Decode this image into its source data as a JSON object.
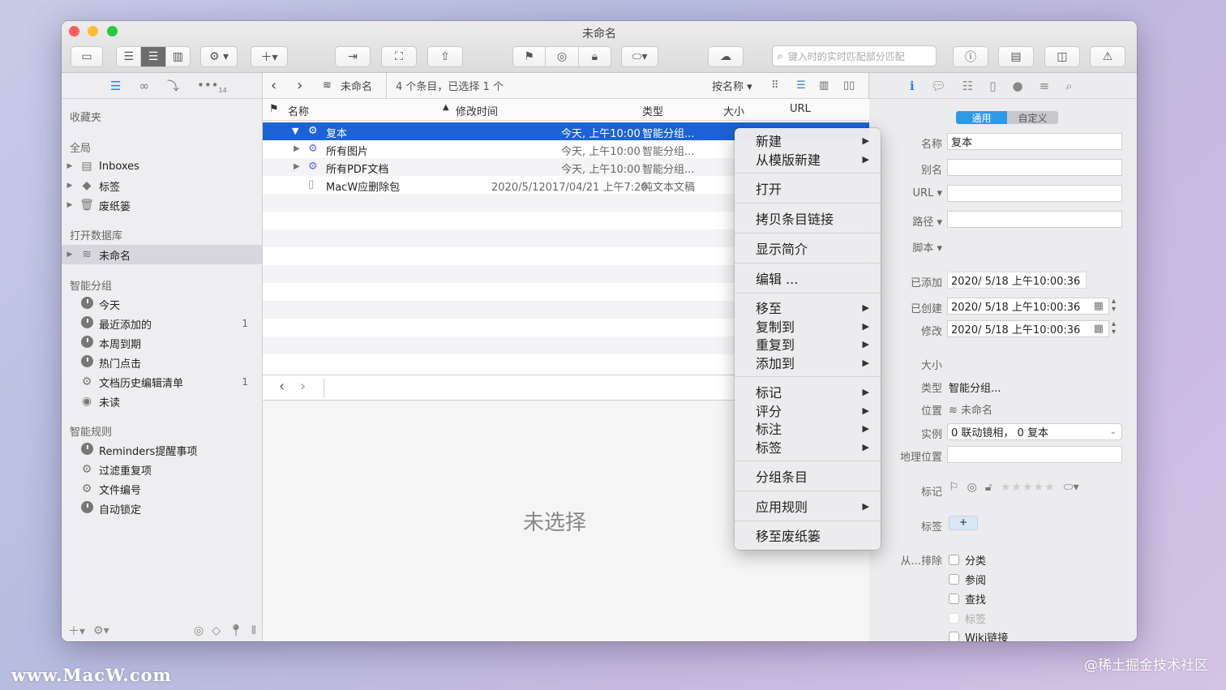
{
  "window": {
    "title": "未命名"
  },
  "toolbar": {
    "search_placeholder": "键入时的实时匹配部分匹配"
  },
  "sidebar": {
    "favorites_header": "收藏夹",
    "global_header": "全局",
    "global_items": [
      "Inboxes",
      "标签",
      "废纸篓"
    ],
    "open_db_header": "打开数据库",
    "open_db_items": [
      "未命名"
    ],
    "smart_groups_header": "智能分组",
    "smart_groups": [
      {
        "label": "今天",
        "count": ""
      },
      {
        "label": "最近添加的",
        "count": "1"
      },
      {
        "label": "本周到期",
        "count": ""
      },
      {
        "label": "热门点击",
        "count": ""
      },
      {
        "label": "文档历史编辑清单",
        "count": "1"
      },
      {
        "label": "未读",
        "count": ""
      }
    ],
    "smart_rules_header": "智能规则",
    "smart_rules": [
      "Reminders提醒事项",
      "过滤重复项",
      "文件编号",
      "自动锁定"
    ],
    "tab_badge": "14"
  },
  "main": {
    "breadcrumb": "未命名",
    "status": "4 个条目，已选择 1 个",
    "sort_label": "按名称",
    "columns": {
      "name": "名称",
      "modified": "修改时间",
      "type": "类型",
      "size": "大小",
      "url": "URL"
    },
    "rows": [
      {
        "name": "复本",
        "modified": "今天, 上午10:00",
        "type": "智能分组..."
      },
      {
        "name": "所有图片",
        "modified": "今天, 上午10:00",
        "type": "智能分组..."
      },
      {
        "name": "所有PDF文档",
        "modified": "今天, 上午10:00",
        "type": "智能分组..."
      },
      {
        "name": "MacW应删除包",
        "modified": "2020/5/12017/04/21 上午7:20",
        "type": "纯文本文稿"
      }
    ],
    "empty_text": "未选择"
  },
  "context_menu": {
    "items": [
      "新建",
      "从模版新建",
      "打开",
      "拷贝条目链接",
      "显示简介",
      "编辑 ...",
      "移至",
      "复制到",
      "重复到",
      "添加到",
      "标记",
      "评分",
      "标注",
      "标签",
      "分组条目",
      "应用规则",
      "移至废纸篓"
    ]
  },
  "inspector": {
    "tab_general": "通用",
    "tab_custom": "自定义",
    "name_label": "名称",
    "name_value": "复本",
    "alias_label": "别名",
    "url_label": "URL",
    "path_label": "路径",
    "script_label": "脚本",
    "added_label": "已添加",
    "added_value": "2020/  5/18 上午10:00:36",
    "created_label": "已创建",
    "created_value": "2020/  5/18 上午10:00:36",
    "modified_label": "修改",
    "modified_value": "2020/  5/18 上午10:00:36",
    "size_label": "大小",
    "type_label": "类型",
    "type_value": "智能分组...",
    "location_label": "位置",
    "location_value": "未命名",
    "instance_label": "实例",
    "instance_value": "0 联动镜相，  0 复本",
    "geo_label": "地理位置",
    "mark_label": "标记",
    "tags_label": "标签",
    "tags_add": "+",
    "exclude_label": "从...排除",
    "exclude_items": [
      "分类",
      "参阅",
      "查找",
      "标签",
      "Wiki链接"
    ]
  },
  "watermarks": {
    "left": "www.MacW.com",
    "right": "@稀土掘金技术社区"
  },
  "colors": {
    "accent": "#1b63d6",
    "tab_active": "#2e9ae6"
  }
}
